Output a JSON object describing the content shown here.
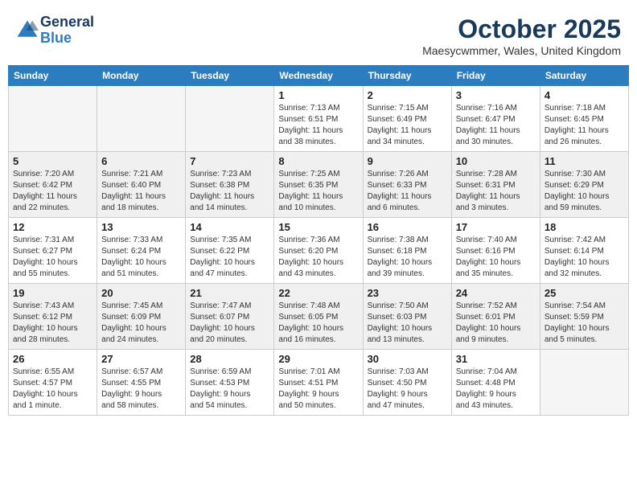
{
  "header": {
    "logo_line1": "General",
    "logo_line2": "Blue",
    "title": "October 2025",
    "subtitle": "Maesycwmmer, Wales, United Kingdom"
  },
  "days_of_week": [
    "Sunday",
    "Monday",
    "Tuesday",
    "Wednesday",
    "Thursday",
    "Friday",
    "Saturday"
  ],
  "weeks": [
    [
      {
        "day": "",
        "info": ""
      },
      {
        "day": "",
        "info": ""
      },
      {
        "day": "",
        "info": ""
      },
      {
        "day": "1",
        "info": "Sunrise: 7:13 AM\nSunset: 6:51 PM\nDaylight: 11 hours\nand 38 minutes."
      },
      {
        "day": "2",
        "info": "Sunrise: 7:15 AM\nSunset: 6:49 PM\nDaylight: 11 hours\nand 34 minutes."
      },
      {
        "day": "3",
        "info": "Sunrise: 7:16 AM\nSunset: 6:47 PM\nDaylight: 11 hours\nand 30 minutes."
      },
      {
        "day": "4",
        "info": "Sunrise: 7:18 AM\nSunset: 6:45 PM\nDaylight: 11 hours\nand 26 minutes."
      }
    ],
    [
      {
        "day": "5",
        "info": "Sunrise: 7:20 AM\nSunset: 6:42 PM\nDaylight: 11 hours\nand 22 minutes."
      },
      {
        "day": "6",
        "info": "Sunrise: 7:21 AM\nSunset: 6:40 PM\nDaylight: 11 hours\nand 18 minutes."
      },
      {
        "day": "7",
        "info": "Sunrise: 7:23 AM\nSunset: 6:38 PM\nDaylight: 11 hours\nand 14 minutes."
      },
      {
        "day": "8",
        "info": "Sunrise: 7:25 AM\nSunset: 6:35 PM\nDaylight: 11 hours\nand 10 minutes."
      },
      {
        "day": "9",
        "info": "Sunrise: 7:26 AM\nSunset: 6:33 PM\nDaylight: 11 hours\nand 6 minutes."
      },
      {
        "day": "10",
        "info": "Sunrise: 7:28 AM\nSunset: 6:31 PM\nDaylight: 11 hours\nand 3 minutes."
      },
      {
        "day": "11",
        "info": "Sunrise: 7:30 AM\nSunset: 6:29 PM\nDaylight: 10 hours\nand 59 minutes."
      }
    ],
    [
      {
        "day": "12",
        "info": "Sunrise: 7:31 AM\nSunset: 6:27 PM\nDaylight: 10 hours\nand 55 minutes."
      },
      {
        "day": "13",
        "info": "Sunrise: 7:33 AM\nSunset: 6:24 PM\nDaylight: 10 hours\nand 51 minutes."
      },
      {
        "day": "14",
        "info": "Sunrise: 7:35 AM\nSunset: 6:22 PM\nDaylight: 10 hours\nand 47 minutes."
      },
      {
        "day": "15",
        "info": "Sunrise: 7:36 AM\nSunset: 6:20 PM\nDaylight: 10 hours\nand 43 minutes."
      },
      {
        "day": "16",
        "info": "Sunrise: 7:38 AM\nSunset: 6:18 PM\nDaylight: 10 hours\nand 39 minutes."
      },
      {
        "day": "17",
        "info": "Sunrise: 7:40 AM\nSunset: 6:16 PM\nDaylight: 10 hours\nand 35 minutes."
      },
      {
        "day": "18",
        "info": "Sunrise: 7:42 AM\nSunset: 6:14 PM\nDaylight: 10 hours\nand 32 minutes."
      }
    ],
    [
      {
        "day": "19",
        "info": "Sunrise: 7:43 AM\nSunset: 6:12 PM\nDaylight: 10 hours\nand 28 minutes."
      },
      {
        "day": "20",
        "info": "Sunrise: 7:45 AM\nSunset: 6:09 PM\nDaylight: 10 hours\nand 24 minutes."
      },
      {
        "day": "21",
        "info": "Sunrise: 7:47 AM\nSunset: 6:07 PM\nDaylight: 10 hours\nand 20 minutes."
      },
      {
        "day": "22",
        "info": "Sunrise: 7:48 AM\nSunset: 6:05 PM\nDaylight: 10 hours\nand 16 minutes."
      },
      {
        "day": "23",
        "info": "Sunrise: 7:50 AM\nSunset: 6:03 PM\nDaylight: 10 hours\nand 13 minutes."
      },
      {
        "day": "24",
        "info": "Sunrise: 7:52 AM\nSunset: 6:01 PM\nDaylight: 10 hours\nand 9 minutes."
      },
      {
        "day": "25",
        "info": "Sunrise: 7:54 AM\nSunset: 5:59 PM\nDaylight: 10 hours\nand 5 minutes."
      }
    ],
    [
      {
        "day": "26",
        "info": "Sunrise: 6:55 AM\nSunset: 4:57 PM\nDaylight: 10 hours\nand 1 minute."
      },
      {
        "day": "27",
        "info": "Sunrise: 6:57 AM\nSunset: 4:55 PM\nDaylight: 9 hours\nand 58 minutes."
      },
      {
        "day": "28",
        "info": "Sunrise: 6:59 AM\nSunset: 4:53 PM\nDaylight: 9 hours\nand 54 minutes."
      },
      {
        "day": "29",
        "info": "Sunrise: 7:01 AM\nSunset: 4:51 PM\nDaylight: 9 hours\nand 50 minutes."
      },
      {
        "day": "30",
        "info": "Sunrise: 7:03 AM\nSunset: 4:50 PM\nDaylight: 9 hours\nand 47 minutes."
      },
      {
        "day": "31",
        "info": "Sunrise: 7:04 AM\nSunset: 4:48 PM\nDaylight: 9 hours\nand 43 minutes."
      },
      {
        "day": "",
        "info": ""
      }
    ]
  ]
}
